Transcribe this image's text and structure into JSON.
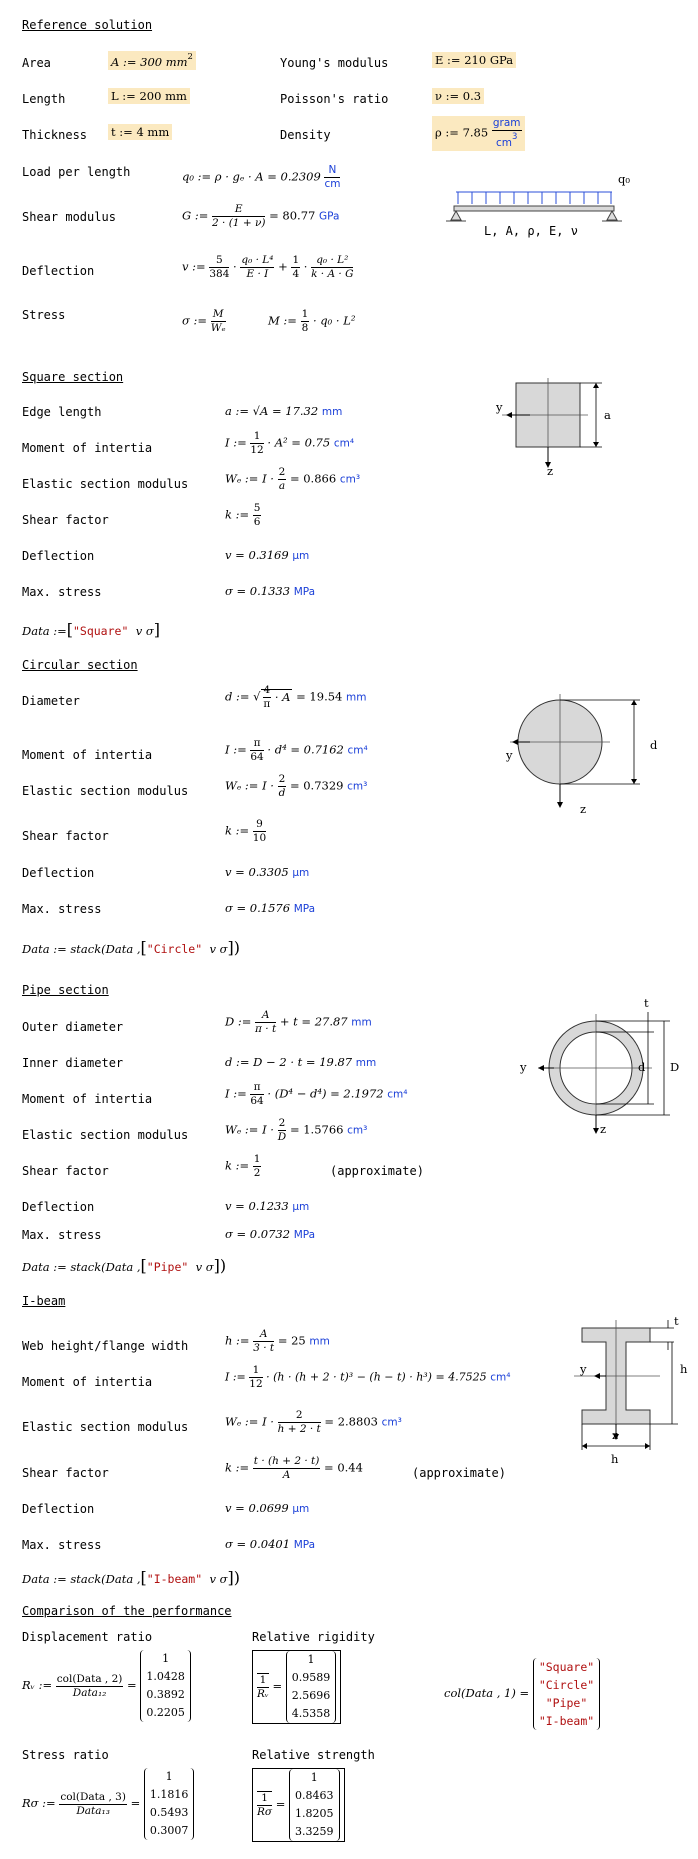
{
  "ref": {
    "header": "Reference solution",
    "area_label": "Area",
    "area_eq": "A := 300 mm",
    "area_exp": "2",
    "length_label": "Length",
    "length_eq": "L := 200 mm",
    "thickness_label": "Thickness",
    "thickness_eq": "t := 4 mm",
    "youngs_label": "Young's modulus",
    "youngs_eq": "E := 210 GPa",
    "poisson_label": "Poisson's ratio",
    "poisson_eq": "ν := 0.3",
    "density_label": "Density",
    "density_eq": "ρ := 7.85",
    "density_unit_num": "gram",
    "density_unit_den": "cm",
    "density_unit_exp": "3",
    "load_label": "Load per length",
    "load_eq": "q₀ := ρ · gₑ · A = 0.2309",
    "load_unit_num": "N",
    "load_unit_den": "cm",
    "shear_label": "Shear modulus",
    "shear_lhs": "G :=",
    "shear_num": "E",
    "shear_den": "2 · (1 + ν)",
    "shear_res": "= 80.77",
    "shear_unit": "GPa",
    "deflection_label": "Deflection",
    "deflection_lhs": "v :=",
    "deflection_c1_num": "5",
    "deflection_c1_den": "384",
    "deflection_t1_num": "q₀ · L⁴",
    "deflection_t1_den": "E · I",
    "deflection_plus": "+",
    "deflection_c2_num": "1",
    "deflection_c2_den": "4",
    "deflection_t2_num": "q₀ · L²",
    "deflection_t2_den": "k · A · G",
    "stress_label": "Stress",
    "stress_lhs": "σ :=",
    "stress_num": "M",
    "stress_den": "Wₑ",
    "moment_lhs": "M :=",
    "moment_c_num": "1",
    "moment_c_den": "8",
    "moment_rest": "· q₀ · L²",
    "beam_labels": "L, A, ρ, E, ν",
    "beam_load": "q₀"
  },
  "square": {
    "header": "Square section",
    "edge_label": "Edge length",
    "edge_eq": "a := √A = 17.32",
    "edge_unit": "mm",
    "moment_label": "Moment of intertia",
    "moment_lhs": "I :=",
    "moment_num": "1",
    "moment_den": "12",
    "moment_rest": "· A² = 0.75",
    "moment_unit": "cm⁴",
    "elastic_label": "Elastic section modulus",
    "elastic_lhs": "Wₑ := I ·",
    "elastic_num": "2",
    "elastic_den": "a",
    "elastic_res": "= 0.866",
    "elastic_unit": "cm³",
    "shearf_label": "Shear factor",
    "shearf_lhs": "k :=",
    "shearf_num": "5",
    "shearf_den": "6",
    "defl_label": "Deflection",
    "defl_eq": "v = 0.3169",
    "defl_unit": "µm",
    "maxs_label": "Max. stress",
    "maxs_eq": "σ = 0.1333",
    "maxs_unit": "MPa",
    "data_lhs": "Data :=",
    "data_name": "\"Square\"",
    "data_vars": "v  σ",
    "fig_y": "y",
    "fig_z": "z",
    "fig_a": "a"
  },
  "circle": {
    "header": "Circular section",
    "diam_label": "Diameter",
    "diam_lhs": "d :=",
    "diam_num": "4",
    "diam_den": "π",
    "diam_rest": "· A",
    "diam_res": "= 19.54",
    "diam_unit": "mm",
    "moment_label": "Moment of intertia",
    "moment_lhs": "I :=",
    "moment_num": "π",
    "moment_den": "64",
    "moment_rest": "· d⁴ = 0.7162",
    "moment_unit": "cm⁴",
    "elastic_label": "Elastic section modulus",
    "elastic_lhs": "Wₑ := I ·",
    "elastic_num": "2",
    "elastic_den": "d",
    "elastic_res": "= 0.7329",
    "elastic_unit": "cm³",
    "shearf_label": "Shear factor",
    "shearf_lhs": "k :=",
    "shearf_num": "9",
    "shearf_den": "10",
    "defl_label": "Deflection",
    "defl_eq": "v = 0.3305",
    "defl_unit": "µm",
    "maxs_label": "Max. stress",
    "maxs_eq": "σ = 0.1576",
    "maxs_unit": "MPa",
    "data_lhs": "Data := stack(Data ,",
    "data_name": "\"Circle\"",
    "data_vars": "v  σ",
    "fig_y": "y",
    "fig_z": "z",
    "fig_d": "d"
  },
  "pipe": {
    "header": "Pipe section",
    "outer_label": "Outer diameter",
    "outer_lhs": "D :=",
    "outer_num": "A",
    "outer_den": "π · t",
    "outer_res": "+ t = 27.87",
    "outer_unit": "mm",
    "inner_label": "Inner diameter",
    "inner_eq": "d := D − 2 · t = 19.87",
    "inner_unit": "mm",
    "moment_label": "Moment of intertia",
    "moment_lhs": "I :=",
    "moment_num": "π",
    "moment_den": "64",
    "moment_rest": "· (D⁴ − d⁴) = 2.1972",
    "moment_unit": "cm⁴",
    "elastic_label": "Elastic section modulus",
    "elastic_lhs": "Wₑ := I ·",
    "elastic_num": "2",
    "elastic_den": "D",
    "elastic_res": "= 1.5766",
    "elastic_unit": "cm³",
    "shearf_label": "Shear factor",
    "shearf_lhs": "k :=",
    "shearf_num": "1",
    "shearf_den": "2",
    "shearf_note": "(approximate)",
    "defl_label": "Deflection",
    "defl_eq": "v = 0.1233",
    "defl_unit": "µm",
    "maxs_label": "Max. stress",
    "maxs_eq": "σ = 0.0732",
    "maxs_unit": "MPa",
    "data_lhs": "Data := stack(Data ,",
    "data_name": "\"Pipe\"",
    "data_vars": "v  σ",
    "fig_y": "y",
    "fig_z": "z",
    "fig_t": "t",
    "fig_d": "d",
    "fig_D": "D"
  },
  "ibeam": {
    "header": "I-beam",
    "web_label": "Web height/flange width",
    "web_lhs": "h :=",
    "web_num": "A",
    "web_den": "3 · t",
    "web_res": "= 25",
    "web_unit": "mm",
    "moment_label": "Moment of intertia",
    "moment_lhs": "I :=",
    "moment_num": "1",
    "moment_den": "12",
    "moment_rest": "· (h · (h + 2 · t)³ − (h − t) · h³) = 4.7525",
    "moment_unit": "cm⁴",
    "elastic_label": "Elastic section modulus",
    "elastic_lhs": "Wₑ := I ·",
    "elastic_num": "2",
    "elastic_den": "h + 2 · t",
    "elastic_res": "= 2.8803",
    "elastic_unit": "cm³",
    "shearf_label": "Shear factor",
    "shearf_lhs": "k :=",
    "shearf_num": "t · (h + 2 · t)",
    "shearf_den": "A",
    "shearf_res": "= 0.44",
    "shearf_note": "(approximate)",
    "defl_label": "Deflection",
    "defl_eq": "v = 0.0699",
    "defl_unit": "µm",
    "maxs_label": "Max. stress",
    "maxs_eq": "σ = 0.0401",
    "maxs_unit": "MPa",
    "data_lhs": "Data := stack(Data ,",
    "data_name": "\"I-beam\"",
    "data_vars": "v  σ",
    "fig_y": "y",
    "fig_z": "z",
    "fig_t": "t",
    "fig_h_right": "h",
    "fig_h_bottom": "h"
  },
  "compare": {
    "header": "Comparison of the performance",
    "disp_label": "Displacement ratio",
    "rigid_label": "Relative rigidity",
    "stress_label": "Stress ratio",
    "strength_label": "Relative strength",
    "rv_lhs": "Rᵥ :=",
    "rv_num": "col(Data , 2)",
    "rv_den": "Data₁₂",
    "rv_values": [
      "1",
      "1.0428",
      "0.3892",
      "0.2205"
    ],
    "rigid_lhs_num": "1",
    "rigid_lhs_den": "Rᵥ",
    "rigid_values": [
      "1",
      "0.9589",
      "2.5696",
      "4.5358"
    ],
    "col_lhs": "col(Data , 1) =",
    "col_values": [
      "\"Square\"",
      "\"Circle\"",
      "\"Pipe\"",
      "\"I-beam\""
    ],
    "rs_lhs": "Rσ :=",
    "rs_num": "col(Data , 3)",
    "rs_den": "Data₁₃",
    "rs_values": [
      "1",
      "1.1816",
      "0.5493",
      "0.3007"
    ],
    "strength_lhs_num": "1",
    "strength_lhs_den": "Rσ",
    "strength_values": [
      "1",
      "0.8463",
      "1.8205",
      "3.3259"
    ]
  }
}
